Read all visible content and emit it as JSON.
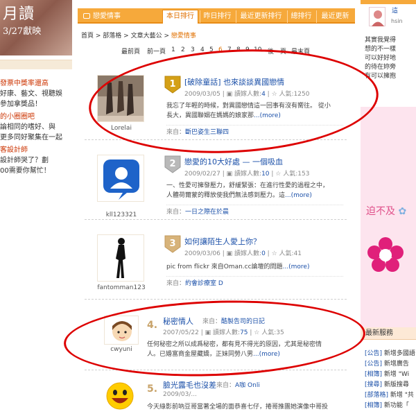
{
  "left": {
    "banner_title": "月讀",
    "banner_date": "3/27獻映",
    "promos": [
      {
        "headline": "發票中獎率還高",
        "lines": [
          "好康、藝文、視聽娛",
          "參加拿獎品！"
        ]
      },
      {
        "headline": "的小圈圈吧",
        "lines": [
          "論相同的嗜好、與",
          "更多同好聚集在一起"
        ]
      },
      {
        "headline": "客設計師",
        "lines": [
          "設計師哭了？劃",
          "00需要你幫忙！"
        ]
      }
    ]
  },
  "center": {
    "section_title": "戀愛情事",
    "tabs": [
      "本日排行",
      "昨日排行",
      "最近更新排行",
      "總排行",
      "最近更新"
    ],
    "breadcrumb": {
      "items": [
        "首頁",
        "部落格",
        "文章大藝公",
        "戀愛情事"
      ],
      "sep": " > "
    },
    "pager": {
      "first": "最前頁",
      "prev": "前一頁",
      "pages": [
        "1",
        "2",
        "3",
        "4",
        "5",
        "6",
        "7",
        "8",
        "9",
        "10"
      ],
      "current": "6",
      "next": "後一頁",
      "last": "最末頁"
    },
    "entries": [
      {
        "rank": "1",
        "title": "[破除童話] 也來談談異國戀情",
        "date": "2009/03/05",
        "readers_label": "讀嫁人數:",
        "readers": "4",
        "popularity_label": "人氣:",
        "popularity": "1250",
        "excerpt": "我忘了年輕的時候，對異國戀情這一回事有沒有嚮往。 從小長大，異國聯姻在媽媽的娘家那",
        "more": "...(more)",
        "source_label": "來自：",
        "source": "斷巴姿生三聯四",
        "username": "Lorelai"
      },
      {
        "rank": "2",
        "title": "戀愛的10大好處 — 一個吸血",
        "date": "2009/02/27",
        "readers_label": "讀嫁人數:",
        "readers": "10",
        "popularity_label": "人氣:",
        "popularity": "153",
        "excerpt": "一、性愛可擁發壓力，舒緩緊張：在進行性愛的過程之中，人體荷爾蒙的釋放使我們無法感到壓力。這",
        "more": "...(more)",
        "source_label": "來自：",
        "source": "一日之際在於晨",
        "username": "kll123321"
      },
      {
        "rank": "3",
        "title": "如何讓陌生人愛上你？",
        "date": "2009/03/06",
        "readers_label": "讀嫁人數:",
        "readers": "0",
        "popularity_label": "人氣:",
        "popularity": "41",
        "excerpt": "pic from flickr  來自Oman.cc論壇的問題",
        "more": "...(more)",
        "source_label": "來自：",
        "source": "約會診療室 D",
        "username": "fantomman123"
      },
      {
        "rank": "4.",
        "title": "秘密情人",
        "author_label": "來自：",
        "author": "酷製告司的日記",
        "date": "2007/05/22",
        "readers_label": "讀嫁人數:",
        "readers": "75",
        "popularity_label": "人氣:",
        "popularity": "35",
        "excerpt": "任何秘密之所以成爲秘密，都有見不得光的原因，尤其是秘密情人。已婚富商金屋藏嬌，正妹同勞八男",
        "more": "...(more)",
        "username": "cwyuni"
      },
      {
        "rank": "5.",
        "title": "臉光露毛也沒差",
        "author_label": "來自：",
        "author": "A咖 Onli",
        "date": "2009/03/...",
        "excerpt": "今天綠影前吶豆哥當著全場的面恭喜七仔，捲哥推團她演像中哥投",
        "username": "celeee"
      }
    ]
  },
  "right": {
    "profile_name": "這",
    "profile_sub": "hsin",
    "text_lines": [
      "其實我覺得",
      "想的不一樣",
      "可以好好地",
      "的待在妳旁",
      "有可以擁抱"
    ],
    "ad_slogan": "迫不及",
    "services_title": "最新服務",
    "services": [
      {
        "tag": "[公告]",
        "text": "新增多國語"
      },
      {
        "tag": "[公告]",
        "text": "新增廣告"
      },
      {
        "tag": "[相簿]",
        "text": "新增 \"Wi"
      },
      {
        "tag": "[搜尋]",
        "text": "新版搜尋"
      },
      {
        "tag": "[部落格]",
        "text": "新增 \"共"
      },
      {
        "tag": "[相簿]",
        "text": "新功能「"
      }
    ]
  },
  "colors": {
    "accent": "#f6a93b",
    "link": "#1a4fa8",
    "annotation": "#dd0000",
    "highlight": "#e07000"
  }
}
